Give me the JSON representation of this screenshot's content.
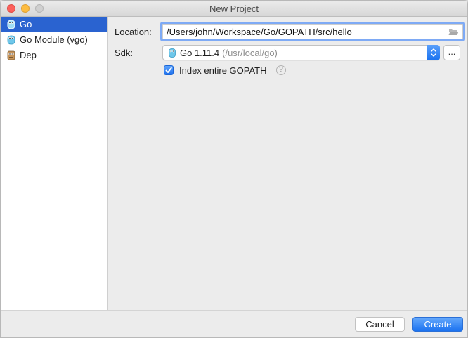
{
  "window": {
    "title": "New Project"
  },
  "sidebar": {
    "items": [
      {
        "label": "Go",
        "icon": "gopher-icon",
        "selected": true
      },
      {
        "label": "Go Module (vgo)",
        "icon": "gopher-icon",
        "selected": false
      },
      {
        "label": "Dep",
        "icon": "dep-icon",
        "selected": false
      }
    ]
  },
  "form": {
    "location_label": "Location:",
    "location_value": "/Users/john/Workspace/Go/GOPATH/src/hello",
    "sdk_label": "Sdk:",
    "sdk_name": "Go 1.11.4",
    "sdk_path": "(/usr/local/go)",
    "sdk_browse_label": "...",
    "index_label": "Index entire GOPATH",
    "index_checked": true,
    "help_label": "?"
  },
  "footer": {
    "cancel_label": "Cancel",
    "create_label": "Create"
  },
  "colors": {
    "accent": "#2a63d0",
    "focus_ring": "#7eaaf5",
    "button_primary": "#1b72f0"
  }
}
